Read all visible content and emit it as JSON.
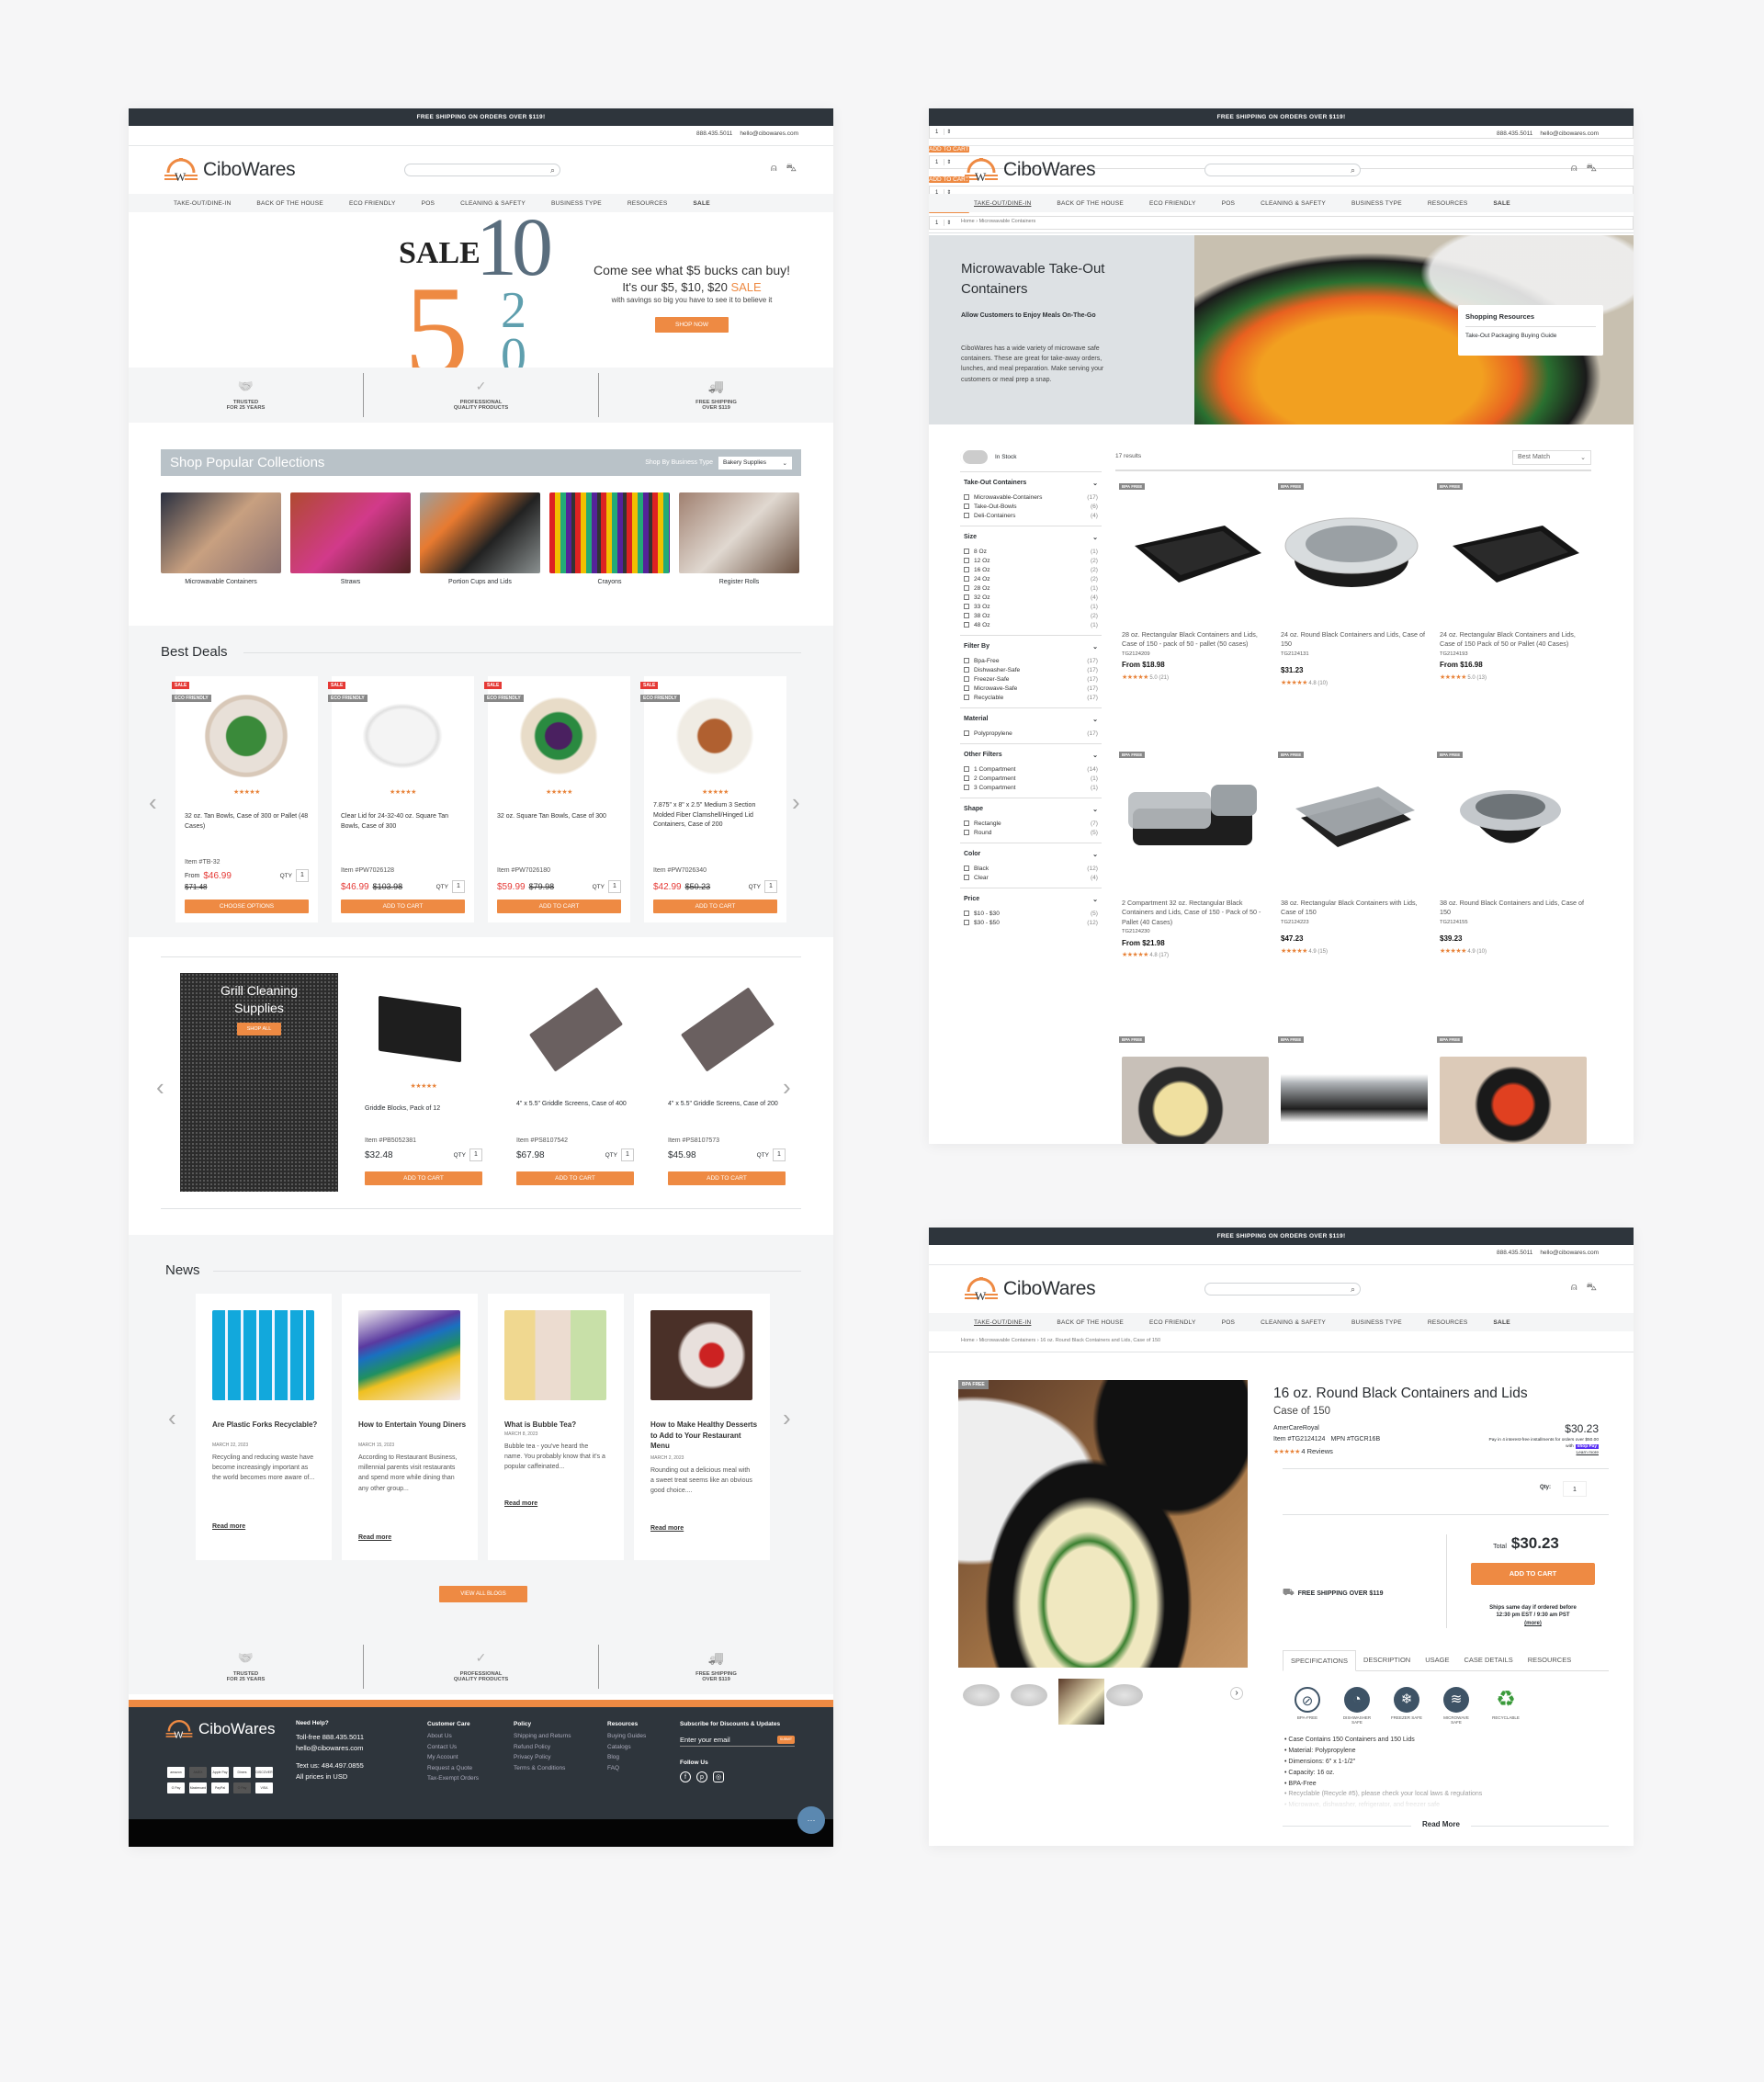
{
  "colors": {
    "accent": "#ee8a43",
    "dark": "#2e353c",
    "sale_red": "#e53935",
    "badge_gray": "#888888"
  },
  "header": {
    "promo": "FREE SHIPPING ON ORDERS OVER $119!",
    "phone": "888.435.5011",
    "email": "hello@cibowares.com",
    "logo": "CiboWares",
    "search_placeholder": "",
    "icons": [
      "search-icon",
      "user-icon",
      "cart-icon"
    ],
    "nav": [
      "TAKE-OUT/DINE-IN",
      "BACK OF THE HOUSE",
      "ECO FRIENDLY",
      "POS",
      "CLEANING & SAFETY",
      "BUSINESS TYPE",
      "RESOURCES",
      "SALE"
    ]
  },
  "home": {
    "hero": {
      "sale_word": "SALE",
      "n5": "5",
      "n10": "10",
      "n20": "20",
      "dollar": "$",
      "line1": "Come see what $5 bucks can buy!",
      "line2_pre": "It's our $5, $10, $20 ",
      "line2_sale": "SALE",
      "line3": "with savings so big you have to see it to believe it",
      "cta": "SHOP NOW"
    },
    "features": [
      {
        "icon": "handshake-icon",
        "l1": "TRUSTED",
        "l2": "FOR 25 YEARS"
      },
      {
        "icon": "award-badge-icon",
        "l1": "PROFESSIONAL",
        "l2": "QUALITY PRODUCTS"
      },
      {
        "icon": "truck-icon",
        "l1": "FREE SHIPPING",
        "l2": "OVER $119"
      }
    ],
    "collections": {
      "title": "Shop Popular Collections",
      "filter_label": "Shop By Business Type",
      "filter_value": "Bakery Supplies",
      "items": [
        "Microwavable Containers",
        "Straws",
        "Portion Cups and Lids",
        "Crayons",
        "Register Rolls"
      ]
    },
    "best_deals": {
      "title": "Best Deals",
      "sale_tag": "SALE",
      "eco_tag": "ECO FRIENDLY",
      "qty_label": "QTY",
      "items": [
        {
          "name": "32 oz. Tan Bowls, Case of 300 or Pallet (48 Cases)",
          "item": "Item #TB-32",
          "from": "From ",
          "price": "$46.99",
          "old": "$71.48",
          "qty": "1",
          "button": "CHOOSE OPTIONS",
          "stars": 5
        },
        {
          "name": "Clear Lid for 24-32-40 oz. Square Tan Bowls, Case of 300",
          "item": "Item #PW7026128",
          "from": "",
          "price": "$46.99",
          "old": "$103.98",
          "qty": "1",
          "button": "ADD TO CART",
          "stars": 5
        },
        {
          "name": "32 oz. Square Tan Bowls, Case of 300",
          "item": "Item #PW7026180",
          "from": "",
          "price": "$59.99",
          "old": "$79.98",
          "qty": "1",
          "button": "ADD TO CART",
          "stars": 5
        },
        {
          "name": "7.875\" x 8\" x 2.5\" Medium 3 Section Molded Fiber Clamshell/Hinged Lid Containers, Case of 200",
          "item": "Item #PW7026340",
          "from": "",
          "price": "$42.99",
          "old": "$50.23",
          "qty": "1",
          "button": "ADD TO CART",
          "stars": 5
        }
      ]
    },
    "grill": {
      "title": "Grill Cleaning Supplies",
      "cta": "SHOP ALL",
      "qty_label": "QTY",
      "items": [
        {
          "name": "Griddle Blocks, Pack of 12",
          "item": "Item #PB5052381",
          "price": "$32.48",
          "qty": "1",
          "button": "ADD TO CART",
          "stars": 5
        },
        {
          "name": "4\" x 5.5\" Griddle Screens, Case of 400",
          "item": "Item #PS8107542",
          "price": "$67.98",
          "qty": "1",
          "button": "ADD TO CART",
          "stars": 0
        },
        {
          "name": "4\" x 5.5\" Griddle Screens, Case of 200",
          "item": "Item #PS8107573",
          "price": "$45.98",
          "qty": "1",
          "button": "ADD TO CART",
          "stars": 0
        }
      ]
    },
    "news": {
      "title": "News",
      "read_more": "Read more",
      "view_all": "VIEW ALL BLOGS",
      "items": [
        {
          "title": "Are Plastic Forks Recyclable?",
          "date": "MARCH 22, 2023",
          "text": "Recycling and reducing waste have become increasingly important as the world becomes more aware of..."
        },
        {
          "title": "How to Entertain Young Diners",
          "date": "MARCH 15, 2023",
          "text": "According to Restaurant Business, millennial parents visit restaurants and spend more while dining than any other group..."
        },
        {
          "title": "What is Bubble Tea?",
          "date": "MARCH 8, 2023",
          "text": "Bubble tea - you've heard the name. You probably know that it's a popular caffeinated..."
        },
        {
          "title": "How to Make Healthy Desserts to Add to Your Restaurant Menu",
          "date": "MARCH 2, 2023",
          "text": "Rounding out a delicious meal with a sweet treat seems like an obvious good choice...."
        }
      ]
    },
    "footer": {
      "help_title": "Need Help?",
      "tollfree": "Toll-free 888.435.5011",
      "email": "hello@cibowares.com",
      "text_us": "Text us: 484.497.0855",
      "usd": "All prices in USD",
      "payments": [
        "amazon",
        "AMEX",
        "Apple Pay",
        "Diners",
        "DISCOVER",
        "G Pay",
        "Mastercard",
        "PayPal",
        "O Pay",
        "VISA"
      ],
      "columns": [
        {
          "title": "Customer Care",
          "links": [
            "About Us",
            "Contact Us",
            "My Account",
            "Request a Quote",
            "Tax-Exempt Orders"
          ]
        },
        {
          "title": "Policy",
          "links": [
            "Shipping and Returns",
            "Refund Policy",
            "Privacy Policy",
            "Terms & Conditions"
          ]
        },
        {
          "title": "Resources",
          "links": [
            "Buying Guides",
            "Catalogs",
            "Blog",
            "FAQ"
          ]
        }
      ],
      "subscribe_title": "Subscribe for Discounts & Updates",
      "email_placeholder": "Enter your email",
      "submit": "SUBMIT",
      "follow": "Follow Us",
      "social": [
        "facebook-icon",
        "pinterest-icon",
        "instagram-icon"
      ]
    }
  },
  "category": {
    "breadcrumb": [
      "Home",
      "Microwavable Containers"
    ],
    "title": "Microwavable Take-Out Containers",
    "subtitle": "Allow Customers to Enjoy Meals On-The-Go",
    "desc": "CiboWares has a wide variety of microwave safe containers. These are great for take-away orders, lunches, and meal preparation. Make serving your customers or meal prep a snap.",
    "resources_title": "Shopping Resources",
    "resources_link": "Take-Out Packaging Buying Guide",
    "in_stock": "In Stock",
    "in_stock_on": false,
    "results": "17 results",
    "sort": "Best Match",
    "filters": [
      {
        "title": "Take-Out Containers",
        "options": [
          [
            "Microwavable-Containers",
            "(17)"
          ],
          [
            "Take-Out-Bowls",
            "(6)"
          ],
          [
            "Deli-Containers",
            "(4)"
          ]
        ]
      },
      {
        "title": "Size",
        "options": [
          [
            "8 Oz",
            "(1)"
          ],
          [
            "12 Oz",
            "(2)"
          ],
          [
            "16 Oz",
            "(2)"
          ],
          [
            "24 Oz",
            "(2)"
          ],
          [
            "28 Oz",
            "(1)"
          ],
          [
            "32 Oz",
            "(4)"
          ],
          [
            "33 Oz",
            "(1)"
          ],
          [
            "38 Oz",
            "(2)"
          ],
          [
            "48 Oz",
            "(1)"
          ]
        ]
      },
      {
        "title": "Filter By",
        "options": [
          [
            "Bpa-Free",
            "(17)"
          ],
          [
            "Dishwasher-Safe",
            "(17)"
          ],
          [
            "Freezer-Safe",
            "(17)"
          ],
          [
            "Microwave-Safe",
            "(17)"
          ],
          [
            "Recyclable",
            "(17)"
          ]
        ]
      },
      {
        "title": "Material",
        "options": [
          [
            "Polypropylene",
            "(17)"
          ]
        ]
      },
      {
        "title": "Other Filters",
        "options": [
          [
            "1 Compartment",
            "(14)"
          ],
          [
            "2 Compartment",
            "(1)"
          ],
          [
            "3 Compartment",
            "(1)"
          ]
        ]
      },
      {
        "title": "Shape",
        "options": [
          [
            "Rectangle",
            "(7)"
          ],
          [
            "Round",
            "(5)"
          ]
        ]
      },
      {
        "title": "Color",
        "options": [
          [
            "Black",
            "(12)"
          ],
          [
            "Clear",
            "(4)"
          ]
        ]
      },
      {
        "title": "Price",
        "options": [
          [
            "$10 - $30",
            "(5)"
          ],
          [
            "$30 - $50",
            "(12)"
          ]
        ]
      }
    ],
    "badge": "BPA FREE",
    "button": "ADD TO CART",
    "products": [
      {
        "name": "28 oz. Rectangular Black Containers and Lids, Case of 150 - pack of 50 - pallet (50 cases)",
        "sku": "TG2124209",
        "price": "From $18.98",
        "rating": "5.0 (21)",
        "qty": "1",
        "shape": "rect"
      },
      {
        "name": "24 oz. Round Black Containers and Lids, Case of 150",
        "sku": "TG2124131",
        "price": "$31.23",
        "rating": "4.8 (10)",
        "qty": "1",
        "shape": "round"
      },
      {
        "name": "24 oz. Rectangular Black Containers and Lids, Case of 150 Pack of 50 or Pallet (40 Cases)",
        "sku": "TG2124193",
        "price": "From $16.98",
        "rating": "5.0 (13)",
        "qty": "1",
        "shape": "rect"
      },
      {
        "name": "2 Compartment 32 oz. Rectangular Black Containers and Lids, Case of 150 - Pack of 50 - Pallet (40 Cases)",
        "sku": "TG2124230",
        "price": "From $21.98",
        "rating": "4.8 (17)",
        "qty": "1",
        "shape": "two"
      },
      {
        "name": "38 oz. Rectangular Black Containers with Lids, Case of 150",
        "sku": "TG2124223",
        "price": "$47.23",
        "rating": "4.9 (15)",
        "qty": "1",
        "shape": "rectlid"
      },
      {
        "name": "38 oz. Round Black Containers and Lids, Case of 150",
        "sku": "TG2124155",
        "price": "$39.23",
        "rating": "4.9 (10)",
        "qty": "1",
        "shape": "roundlid"
      }
    ]
  },
  "product": {
    "breadcrumb": [
      "Home",
      "Microwavable Containers",
      "16 oz. Round Black Containers and Lids, Case of 150"
    ],
    "badge": "BPA FREE",
    "title": "16 oz. Round Black Containers and Lids",
    "subtitle": "Case of 150",
    "brand": "AmerCareRoyal",
    "item": "Item #TG2124124",
    "mpn": "MPN #TGCR16B",
    "reviews": "4 Reviews",
    "price": "$30.23",
    "installments": "Pay in 4 interest-free installments for orders over $50.00 with",
    "shop_pay": "shop Pay",
    "learn_more": "Learn more",
    "qty_label": "Qty:",
    "qty": "1",
    "shipping": "FREE SHIPPING OVER $119",
    "total_label": "Total",
    "total": "$30.23",
    "button": "ADD TO CART",
    "ships1": "Ships same day if ordered before",
    "ships2": "12:30 pm EST / 9:30 am PST",
    "more": "(more)",
    "tabs": [
      "SPECIFICATIONS",
      "DESCRIPTION",
      "USAGE",
      "CASE DETAILS",
      "RESOURCES"
    ],
    "active_tab": 0,
    "spec_icons": [
      {
        "icon": "bpa-free-icon",
        "label": "BPA-FREE"
      },
      {
        "icon": "dishwasher-safe-icon",
        "label": "DISHWASHER SAFE"
      },
      {
        "icon": "freezer-safe-icon",
        "label": "FREEZER SAFE"
      },
      {
        "icon": "microwave-safe-icon",
        "label": "MICROWAVE SAFE"
      },
      {
        "icon": "recyclable-icon",
        "label": "RECYCLABLE"
      }
    ],
    "specs": [
      "Case Contains 150 Containers and 150 Lids",
      "Material: Polypropylene",
      "Dimensions: 6\" x 1-1/2\"",
      "Capacity: 16 oz.",
      "BPA-Free",
      "Recyclable (Recycle #5), please check your local laws & regulations",
      "Microwave, dishwasher, refrigerator, and freezer safe"
    ],
    "read_more": "Read More"
  }
}
